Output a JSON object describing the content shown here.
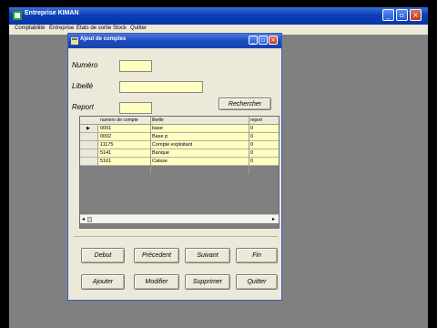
{
  "app": {
    "title": "Entreprise KIMAN"
  },
  "menu": {
    "items": [
      "Comptabilité",
      "Entreprise",
      "Etats de sortie",
      "Stock",
      "Quitter"
    ]
  },
  "dialog": {
    "title": "Ajout de comptes",
    "fields": {
      "numero_label": "Numéro",
      "libelle_label": "Libellé",
      "report_label": "Report",
      "numero_value": "",
      "libelle_value": "",
      "report_value": ""
    },
    "search_button": "Rechercher",
    "grid": {
      "columns": [
        "numero de compte",
        "libelle",
        "report"
      ],
      "rows": [
        [
          "0001",
          "base",
          "0"
        ],
        [
          "0002",
          "Base p",
          "0"
        ],
        [
          "11175",
          "Compte exploitant",
          "0"
        ],
        [
          "5141",
          "Banque",
          "0"
        ],
        [
          "5161",
          "Caisse",
          "0"
        ]
      ]
    },
    "nav_buttons": {
      "debut": "Debut",
      "precedent": "Précedent",
      "suivant": "Suivant",
      "fin": "Fin"
    },
    "action_buttons": {
      "ajouter": "Ajouter",
      "modifier": "Modifier",
      "supprimer": "Supprimer",
      "quitter": "Quitter"
    }
  },
  "colors": {
    "titlebar": "#0a3fb8",
    "input_bg": "#ffffc0",
    "window_bg": "#ece9d8",
    "workspace": "#808080"
  }
}
